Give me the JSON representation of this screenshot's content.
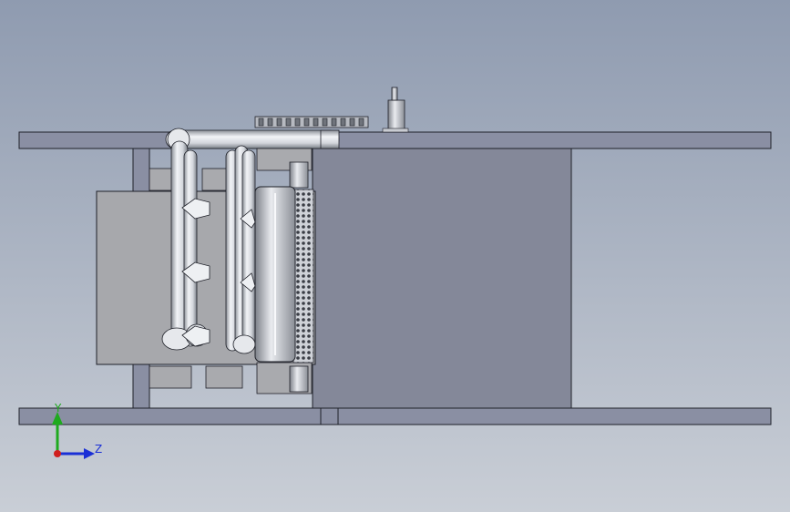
{
  "viewport": {
    "bg_top": "#8f9bb0",
    "bg_bottom": "#c9ced6"
  },
  "colors": {
    "plate": "#8a8fa3",
    "plate_dark": "#6d7286",
    "panel_light": "#a9aaae",
    "pipe_light": "#eceff3",
    "pipe_mid": "#c5c9d0",
    "pipe_dark": "#7f848c",
    "edge": "#1e2028",
    "axis_y": "#1faa1f",
    "axis_z": "#1a2fd6",
    "axis_origin": "#d01f1f"
  },
  "triad": {
    "y_label": "Y",
    "z_label": "Z"
  }
}
